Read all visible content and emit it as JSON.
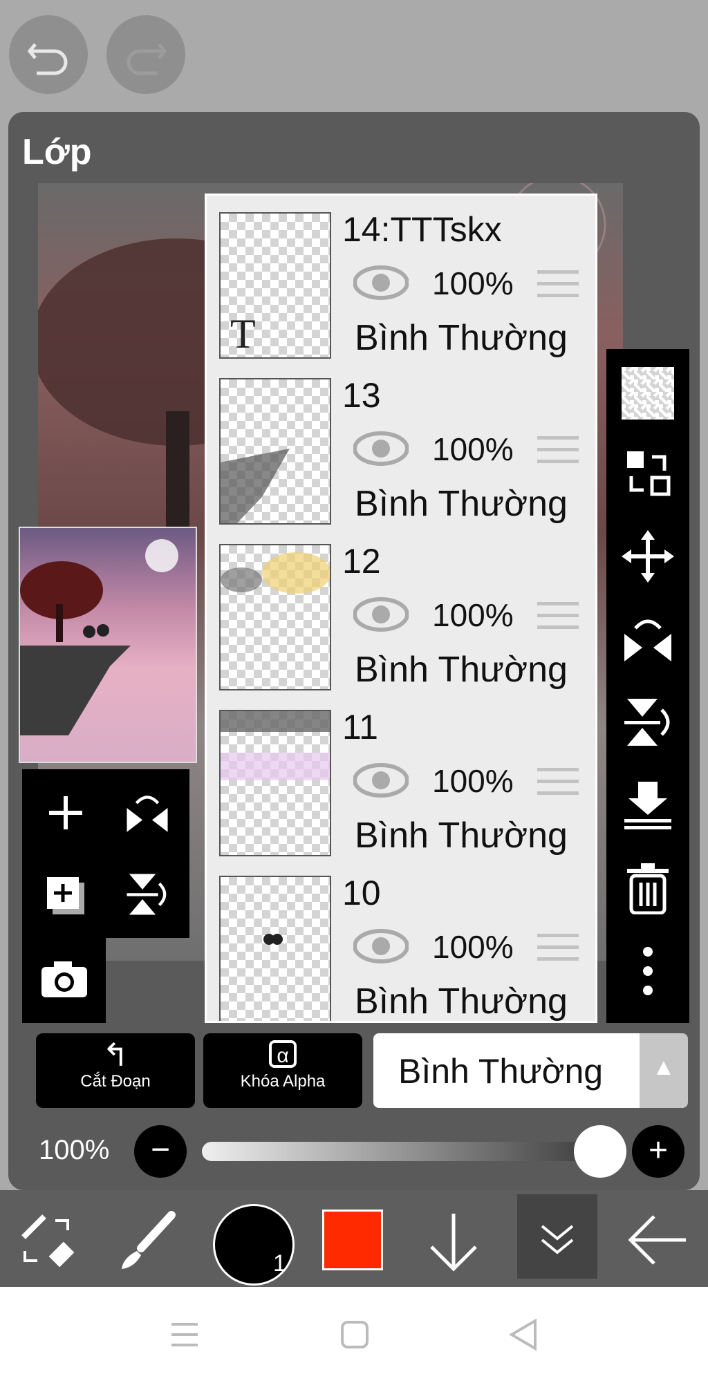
{
  "panel": {
    "title": "Lớp"
  },
  "layers": [
    {
      "name": "14:TTTskx",
      "opacity": "100%",
      "blend": "Bình Thường",
      "thumb_text": "T"
    },
    {
      "name": "13",
      "opacity": "100%",
      "blend": "Bình Thường"
    },
    {
      "name": "12",
      "opacity": "100%",
      "blend": "Bình Thường"
    },
    {
      "name": "11",
      "opacity": "100%",
      "blend": "Bình Thường"
    },
    {
      "name": "10",
      "opacity": "100%",
      "blend": "Bình Thường"
    }
  ],
  "clip_button": {
    "label": "Cắt Đoạn",
    "glyph": "↰"
  },
  "alpha_lock_button": {
    "label": "Khóa Alpha",
    "glyph": "α"
  },
  "blend_mode": {
    "selected": "Bình Thường",
    "arrow": "▲"
  },
  "opacity_slider": {
    "label": "100%",
    "value": 1.0,
    "minus": "−",
    "plus": "+"
  },
  "brush_size": {
    "label": "1"
  },
  "colors": {
    "primary": "#000000",
    "secondary": "#ff2a00",
    "panel": "#5a5a5a",
    "accent_bar": "#000000"
  },
  "icons": [
    "undo-icon",
    "redo-icon",
    "transparent-icon",
    "swap-layer-icon",
    "move-icon",
    "flip-horizontal-icon",
    "flip-vertical-icon",
    "merge-down-icon",
    "trash-icon",
    "more-icon",
    "add-layer-icon",
    "flip-h-icon",
    "add-copy-icon",
    "flip-v-icon",
    "camera-icon"
  ]
}
